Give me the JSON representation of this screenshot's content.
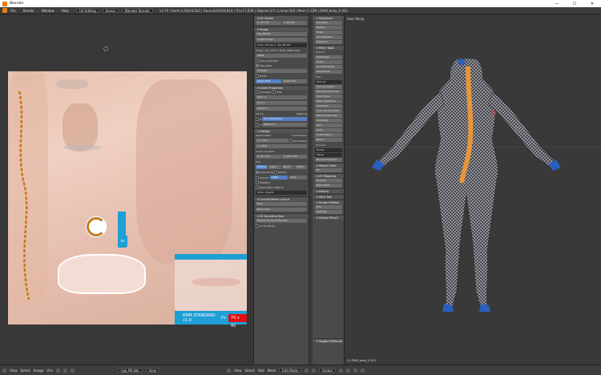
{
  "window": {
    "title": "Blender",
    "minimize": "—",
    "maximize": "☐",
    "close": "✕"
  },
  "infobar": {
    "menus": [
      "File",
      "Render",
      "Window",
      "Help"
    ],
    "layout": "UV Editing",
    "scene": "Scene",
    "engine": "Blender Render",
    "stats": "v2.79 | Verts:4,502/4,502 | Faces:8,814/8,814 | Tris:17,628 | Objects:1/1 | Lamps:0/0 | Mem:1.22M | RHM_body_0.001"
  },
  "uv_editor": {
    "decal_text": "RHM STANDARD v1.0",
    "decal_fx": "Fx",
    "decal_res": "70 x 40",
    "label_blue": "Ax"
  },
  "properties": {
    "uv_vertex": "UV Vertex",
    "uv_x": "X: 217.85",
    "uv_y": "Y: 440.53",
    "image": "Image",
    "image_name": "hjw_PK-dds",
    "source": "Single Image",
    "filepath": "//rhm_female_T...lee_PK.dds",
    "image_info": "Image: size 1024 x 1024, RGBA byte",
    "color_space": "sRGB",
    "view_as_render": "View as Render",
    "use_alpha": "Use Alpha",
    "alpha": "Straight",
    "fields": "Fields",
    "upper_first": "Upper First",
    "lower_first": "Lower First",
    "game_props": "Game Properties",
    "animation": "Animation",
    "tiles": "Tiles",
    "start": "Start: 0",
    "end": "End: 1",
    "speed": "Speed: 5",
    "clamp": "Clamp",
    "mapping": "Mapping",
    "x": "X",
    "y": "Y",
    "uv_coordinates": "UV Coordinates",
    "reflection": "Reflection",
    "display": "Display",
    "aspect_ratio": "Aspect Ratio:",
    "aspect_x": "X: 1.000",
    "aspect_y": "Y: 1.000",
    "coordinates": "Coordinates:",
    "normalized": "Normalized",
    "cursor_location": "Cursor Location",
    "cursor_x": "X: 617.747",
    "cursor_y": "Y: 1017.479",
    "uvs": "UVs",
    "outline": "Outline",
    "dash": "Dash",
    "black": "Black",
    "white": "White",
    "draw_faces": "Draw Faces",
    "smooth": "Smooth",
    "stretch": "Stretch",
    "modified": "Modified",
    "angle": "Angle",
    "area": "Area",
    "draw_other_objects": "Draw Other Objects",
    "other_objects": "Other Objects",
    "uv_layout": "Convert/Mesh Layout",
    "new": "New",
    "new_layer": "New Layer",
    "uv_bounding": "UV Bounding Box",
    "display_bounding": "Display UV Bounding Box",
    "uv_sculpt": "UV Sculpting"
  },
  "tools": {
    "transform": "Transform",
    "translate": "Translate",
    "rotate": "Rotate",
    "scale": "Scale",
    "shrink": "Shrink/Fatten",
    "push_pull": "Push/Pull",
    "mesh_tools": "Mesh Tools",
    "deform": "Deform:",
    "slide_edge": "Slide Edge",
    "vertex": "Vertex",
    "noise": "Noise",
    "smooth_vertex": "Smooth Vertex",
    "randomize": "Randomize",
    "add": "Add:",
    "extrude": "Extrude",
    "extrude_region": "Extrude Region",
    "extrude_individual": "Extrude Individual",
    "inset_faces": "Inset Faces",
    "make_edge_face": "Make Edge/Face",
    "subdivide": "Subdivide",
    "loop_cut": "Loop Cut and Slide",
    "offset_edge": "Offset Edge Slide",
    "duplicate": "Duplicate",
    "spin": "Spin",
    "screw": "Screw",
    "knife": "Knife",
    "select": "Select",
    "knife_project": "Knife Project",
    "bisect": "Bisect",
    "remove": "Remove:",
    "delete": "Delete",
    "merge": "Merge",
    "remove_doubles": "Remove Doubles",
    "weight_tools": "Weight Tools",
    "mesh_opt": "Mesh Options",
    "face_pin": "Pin",
    "uv_mapping": "UV Mapping",
    "unwrap": "Unwrap",
    "mark_seam": "Mark Seam",
    "history": "History",
    "shading": "Shading",
    "view_tool": "View Tool",
    "mesh_tool": "Mesh Tool Tools",
    "image_utilities": "Image Utilities",
    "link": "Link",
    "settings": "Settings",
    "grease_pencil": "Grease Pencil",
    "toggle_editmode": "Toggle Editmode"
  },
  "viewport": {
    "label": "User Persp",
    "object": "(1) RHM_body_0.001"
  },
  "bottombar": {
    "menus_uv": [
      "View",
      "Select",
      "Image",
      "UVs"
    ],
    "image_field": "hjw_PK.dds",
    "view_label": "View",
    "menus_3d": [
      "View",
      "Select",
      "Add",
      "Mesh"
    ],
    "mode": "Edit Mode",
    "pivot": "Global"
  }
}
